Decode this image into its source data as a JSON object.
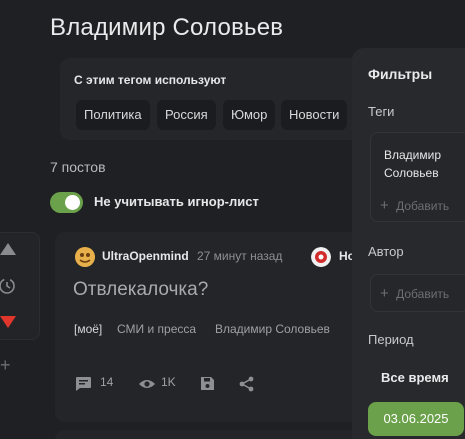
{
  "page": {
    "title": "Владимир Соловьев",
    "tags_caption": "С этим тегом используют",
    "related_tags": [
      "Политика",
      "Россия",
      "Юмор",
      "Новости"
    ],
    "posts_count": "7 постов",
    "ignore_toggle_label": "Не учитывать игнор-лист",
    "ignore_toggle_on": true
  },
  "post": {
    "author": "UltraOpenmind",
    "time": "27 минут назад",
    "second_author": "Но",
    "title": "Отвлекалочка?",
    "tags": [
      "[моё]",
      "СМИ и пресса",
      "Владимир Соловьев"
    ],
    "comments": "14",
    "views": "1K"
  },
  "filters": {
    "title": "Фильтры",
    "tags_label": "Теги",
    "selected_tag": "Владимир Соловьев",
    "add_label": "Добавить",
    "author_label": "Автор",
    "period_label": "Период",
    "period_all": "Все время",
    "period_date": "03.06.2025"
  },
  "colors": {
    "background": "#1f2023",
    "accent": "#6aa14a",
    "downvote": "#e0362b"
  },
  "icons": [
    "upvote-icon",
    "clock-icon",
    "downvote-icon",
    "plus-icon",
    "comment-icon",
    "eye-icon",
    "save-icon",
    "share-icon"
  ]
}
